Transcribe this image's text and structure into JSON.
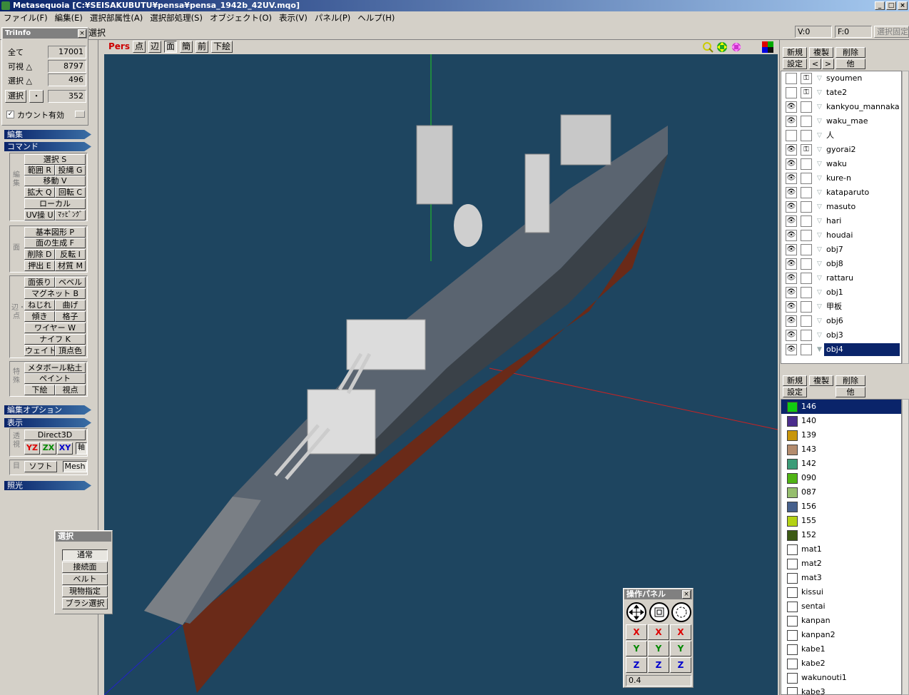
{
  "window": {
    "title": "Metasequoia [C:¥SEISAKUBUTU¥pensa¥pensa_1942b_42UV.mqo]",
    "min": "_",
    "max": "□",
    "close": "×"
  },
  "menu": [
    "ファイル(F)",
    "編集(E)",
    "選択部属性(A)",
    "選択部処理(S)",
    "オブジェクト(O)",
    "表示(V)",
    "パネル(P)",
    "ヘルプ(H)"
  ],
  "top_strip": {
    "edit_label": "選択",
    "v_label": "V:0",
    "f_label": "F:0",
    "fix_label": "選択固定"
  },
  "triinfo": {
    "title": "TriInfo",
    "rows": [
      {
        "label": "全て",
        "value": "17001"
      },
      {
        "label": "可視 △",
        "value": "8797"
      },
      {
        "label": "選択 △",
        "value": "496"
      }
    ],
    "select_label": "選択",
    "dot": "・",
    "select_value": "352",
    "count_label": "カウント有効"
  },
  "sections": {
    "edit": "編集",
    "command": "コマンド",
    "edit_option": "編集オプション",
    "display": "表示",
    "lighting": "照光"
  },
  "groups": {
    "edit": "編集",
    "face": "面",
    "edge": "辺・点",
    "special": "特殊",
    "persp": "透視",
    "grid": "目"
  },
  "commands": {
    "select": "選択 S",
    "range": "範囲 R",
    "lasso": "投縄 G",
    "move": "移動 V",
    "scale": "拡大 Q",
    "rotate": "回転 C",
    "local": "ローカル",
    "uv": "UV操 U",
    "mapping": "ﾏｯﾋﾟﾝｸﾞ",
    "primitive": "基本図形 P",
    "face_create": "面の生成 F",
    "delete": "削除 D",
    "flip": "反転 I",
    "extrude": "押出 E",
    "material": "材質 M",
    "stretch": "面張り",
    "bevel": "ベベル",
    "magnet": "マグネット B",
    "twist": "ねじれ",
    "bend": "曲げ",
    "tilt": "傾き",
    "lattice": "格子",
    "wire": "ワイヤー W",
    "knife": "ナイフ K",
    "weight": "ウェイト",
    "vcolor": "頂点色",
    "metaball": "メタボール粘土",
    "paint": "ペイント",
    "underlay": "下絵",
    "viewpoint": "視点"
  },
  "display": {
    "direct3d": "Direct3D",
    "yz": "YZ",
    "zx": "ZX",
    "xy": "XY",
    "axis": "軸",
    "soft": "ソフト",
    "mesh": "Mesh"
  },
  "view_toolbar": {
    "pers": "Pers",
    "point": "点",
    "edge": "辺",
    "face": "面",
    "simple": "簡",
    "front": "前",
    "underlay": "下絵"
  },
  "select_panel": {
    "title": "選択",
    "items": [
      "通常",
      "接続面",
      "ベルト",
      "現物指定",
      "ブラシ選択"
    ]
  },
  "object_panel": {
    "new": "新規",
    "copy": "複製",
    "delete": "削除",
    "settings": "設定",
    "prev": "<",
    "next": ">",
    "other": "他",
    "objects": [
      {
        "name": "syoumen",
        "visible": false,
        "locked": true,
        "selected": false
      },
      {
        "name": "tate2",
        "visible": false,
        "locked": true,
        "selected": false
      },
      {
        "name": "kankyou_mannaka",
        "visible": true,
        "locked": false,
        "selected": false
      },
      {
        "name": "waku_mae",
        "visible": true,
        "locked": false,
        "selected": false
      },
      {
        "name": "人",
        "visible": false,
        "locked": false,
        "selected": false
      },
      {
        "name": "gyorai2",
        "visible": true,
        "locked": true,
        "selected": false
      },
      {
        "name": "waku",
        "visible": true,
        "locked": false,
        "selected": false
      },
      {
        "name": "kure-n",
        "visible": true,
        "locked": false,
        "selected": false
      },
      {
        "name": "kataparuto",
        "visible": true,
        "locked": false,
        "selected": false
      },
      {
        "name": "masuto",
        "visible": true,
        "locked": false,
        "selected": false
      },
      {
        "name": "hari",
        "visible": true,
        "locked": false,
        "selected": false
      },
      {
        "name": "houdai",
        "visible": true,
        "locked": false,
        "selected": false
      },
      {
        "name": "obj7",
        "visible": true,
        "locked": false,
        "selected": false
      },
      {
        "name": "obj8",
        "visible": true,
        "locked": false,
        "selected": false
      },
      {
        "name": "rattaru",
        "visible": true,
        "locked": false,
        "selected": false
      },
      {
        "name": "obj1",
        "visible": true,
        "locked": false,
        "selected": false
      },
      {
        "name": "甲板",
        "visible": true,
        "locked": false,
        "selected": false
      },
      {
        "name": "obj6",
        "visible": true,
        "locked": false,
        "selected": false
      },
      {
        "name": "obj3",
        "visible": true,
        "locked": false,
        "selected": false
      },
      {
        "name": "obj4",
        "visible": true,
        "locked": false,
        "selected": true
      }
    ]
  },
  "material_panel": {
    "new": "新規",
    "copy": "複製",
    "delete": "削除",
    "settings": "設定",
    "other": "他",
    "materials": [
      {
        "name": "146",
        "color": "#11cc11",
        "selected": true
      },
      {
        "name": "140",
        "color": "#4b2d8c",
        "selected": false
      },
      {
        "name": "139",
        "color": "#c8960a",
        "selected": false
      },
      {
        "name": "143",
        "color": "#b48c6e",
        "selected": false
      },
      {
        "name": "142",
        "color": "#3c9c78",
        "selected": false
      },
      {
        "name": "090",
        "color": "#50b414",
        "selected": false
      },
      {
        "name": "087",
        "color": "#96be6e",
        "selected": false
      },
      {
        "name": "156",
        "color": "#46608c",
        "selected": false
      },
      {
        "name": "155",
        "color": "#b4d214",
        "selected": false
      },
      {
        "name": "152",
        "color": "#3c5a14",
        "selected": false
      },
      {
        "name": "mat1",
        "color": "#ffffff",
        "selected": false
      },
      {
        "name": "mat2",
        "color": "#ffffff",
        "selected": false
      },
      {
        "name": "mat3",
        "color": "#ffffff",
        "selected": false
      },
      {
        "name": "kissui",
        "color": "#ffffff",
        "selected": false
      },
      {
        "name": "sentai",
        "color": "#ffffff",
        "selected": false
      },
      {
        "name": "kanpan",
        "color": "#ffffff",
        "selected": false
      },
      {
        "name": "kanpan2",
        "color": "#ffffff",
        "selected": false
      },
      {
        "name": "kabe1",
        "color": "#ffffff",
        "selected": false
      },
      {
        "name": "kabe2",
        "color": "#ffffff",
        "selected": false
      },
      {
        "name": "wakunouti1",
        "color": "#ffffff",
        "selected": false
      },
      {
        "name": "kabe3",
        "color": "#ffffff",
        "selected": false
      }
    ]
  },
  "control_panel": {
    "title": "操作パネル",
    "x": "X",
    "y": "Y",
    "z": "Z",
    "value": "0.4"
  },
  "colors": {
    "viewport_bg": "#1e4560",
    "title_start": "#0a246a",
    "title_end": "#a6caf0"
  },
  "icons": [
    "app-icon",
    "move-icon",
    "scale-icon",
    "rotate-icon",
    "magnify-icon",
    "pan-icon",
    "eye-icon",
    "lock-icon"
  ]
}
